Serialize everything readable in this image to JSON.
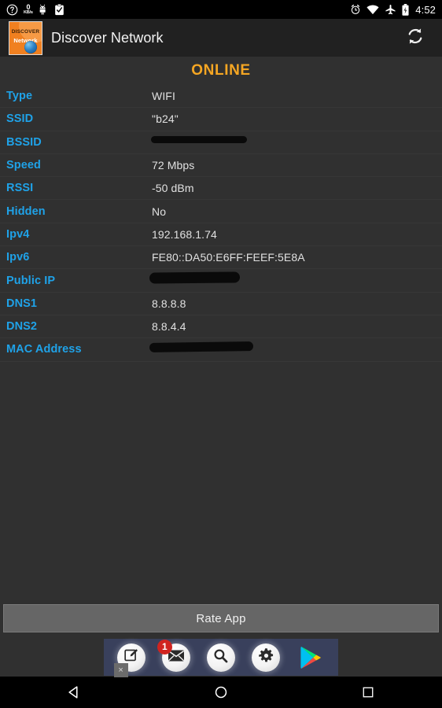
{
  "statusbar": {
    "icons_left": [
      "help-circle-icon",
      "network-speed-indicator",
      "android-robot-icon",
      "clipboard-check-icon"
    ],
    "net_speed_value": "0",
    "net_speed_unit": "KB/s",
    "icons_right": [
      "alarm-clock-icon",
      "wifi-icon",
      "airplane-mode-icon",
      "battery-icon"
    ],
    "time": "4:52"
  },
  "actionbar": {
    "logo_line1": "DISCOVER",
    "logo_line2": "Network",
    "title": "Discover Network",
    "refresh_icon": "refresh-icon"
  },
  "status": {
    "text": "ONLINE",
    "color": "#f5a623"
  },
  "info": {
    "rows": [
      {
        "label": "Type",
        "value": "WIFI",
        "redacted": false
      },
      {
        "label": "SSID",
        "value": "\"b24\"",
        "redacted": false
      },
      {
        "label": "BSSID",
        "value": "",
        "redacted": true
      },
      {
        "label": "Speed",
        "value": "72 Mbps",
        "redacted": false
      },
      {
        "label": "RSSI",
        "value": "-50 dBm",
        "redacted": false
      },
      {
        "label": "Hidden",
        "value": "No",
        "redacted": false
      },
      {
        "label": "Ipv4",
        "value": "192.168.1.74",
        "redacted": false
      },
      {
        "label": "Ipv6",
        "value": "FE80::DA50:E6FF:FEEF:5E8A",
        "redacted": false
      },
      {
        "label": "Public IP",
        "value": "",
        "redacted": true
      },
      {
        "label": "DNS1",
        "value": "8.8.8.8",
        "redacted": false
      },
      {
        "label": "DNS2",
        "value": "8.8.4.4",
        "redacted": false
      },
      {
        "label": "MAC Address",
        "value": "",
        "redacted": true
      }
    ],
    "label_color": "#1fa2e8",
    "value_color": "#e0e0e0"
  },
  "rate_button": {
    "label": "Rate App"
  },
  "ad_banner": {
    "close_label": "×",
    "badge_count": "1",
    "icons": [
      "compose-icon",
      "mail-icon",
      "search-icon",
      "settings-gear-icon",
      "play-store-icon"
    ]
  },
  "navbar": {
    "buttons": [
      "back-button",
      "home-button",
      "recents-button"
    ]
  }
}
